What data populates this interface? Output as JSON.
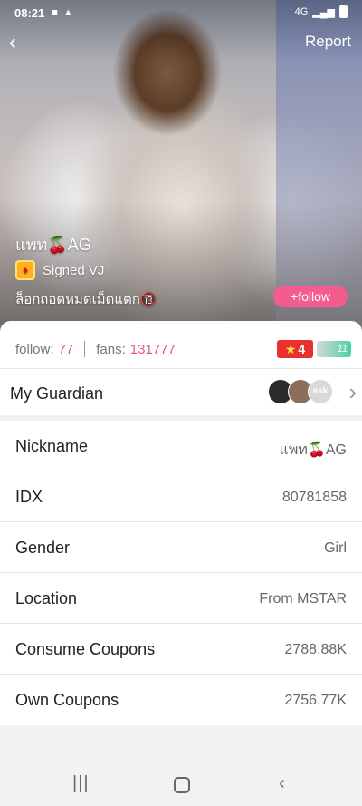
{
  "status": {
    "time": "08:21",
    "icons": [
      "video-icon",
      "warning-icon"
    ],
    "right": "4G"
  },
  "header": {
    "back_icon": "chevron-left-icon",
    "report_label": "Report"
  },
  "profile": {
    "name": "แพท🍒AG",
    "signed_label": "Signed VJ",
    "bio": "ล็อกถอดหมดเม็ดแตก🔞",
    "follow_label": "+follow"
  },
  "stats": {
    "follow_label": "follow:",
    "follow_count": "77",
    "fans_label": "fans:",
    "fans_count": "131777",
    "level": "4",
    "vip_text": "11"
  },
  "guardian": {
    "label": "My Guardian",
    "avatar_text": [
      "",
      "",
      "ask"
    ]
  },
  "details": [
    {
      "label": "Nickname",
      "value": "แพท🍒AG"
    },
    {
      "label": "IDX",
      "value": "80781858"
    },
    {
      "label": "Gender",
      "value": "Girl"
    },
    {
      "label": "Location",
      "value": "From MSTAR"
    },
    {
      "label": "Consume Coupons",
      "value": "2788.88K"
    },
    {
      "label": "Own Coupons",
      "value": "2756.77K"
    }
  ],
  "colors": {
    "accent": "#f25d8e",
    "count_color": "#e15a78",
    "level_badge": "#e8302f"
  }
}
